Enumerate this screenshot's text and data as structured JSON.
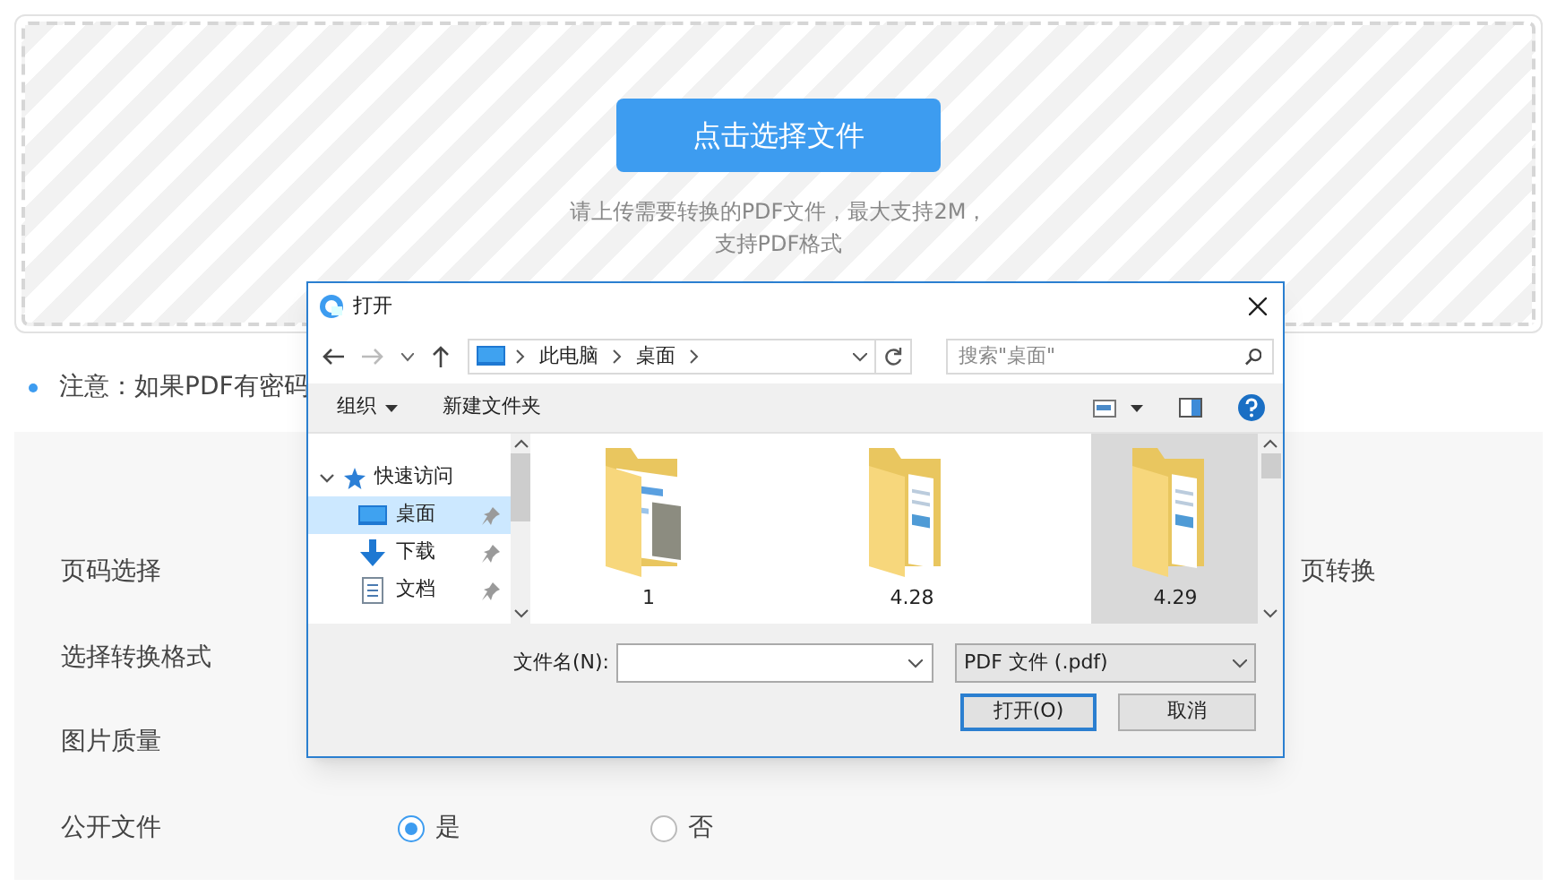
{
  "upload": {
    "button": "点击选择文件",
    "hint": "请上传需要转换的PDF文件，最大支持2M，",
    "hint_line2": "支持PDF格式"
  },
  "note": "注意：如果PDF有密码",
  "settings": [
    {
      "label": "页码选择",
      "trailing": "页转换"
    },
    {
      "label": "选择转换格式"
    },
    {
      "label": "图片质量"
    },
    {
      "label": "公开文件",
      "options": [
        {
          "label": "是",
          "selected": true
        },
        {
          "label": "否",
          "selected": false
        }
      ]
    }
  ],
  "dialog": {
    "title": "打开",
    "breadcrumb": [
      "此电脑",
      "桌面"
    ],
    "search_placeholder": "搜索\"桌面\"",
    "toolbar": [
      "组织",
      "新建文件夹"
    ],
    "nav": [
      {
        "label": "快速访问",
        "expanded": true,
        "children": [
          {
            "label": "桌面",
            "kind": "desktop",
            "selected": true
          },
          {
            "label": "下载",
            "kind": "download",
            "selected": false
          },
          {
            "label": "文档",
            "kind": "document",
            "selected": false
          }
        ]
      }
    ],
    "files": [
      {
        "name": "1",
        "kind": "photos",
        "selected": false
      },
      {
        "name": "4.28",
        "kind": "docs",
        "selected": false
      },
      {
        "name": "4.29",
        "kind": "docs",
        "selected": true
      }
    ],
    "filename_label": "文件名(N):",
    "filter": "PDF 文件 (.pdf)",
    "open_button": "打开(O)",
    "cancel_button": "取消"
  }
}
